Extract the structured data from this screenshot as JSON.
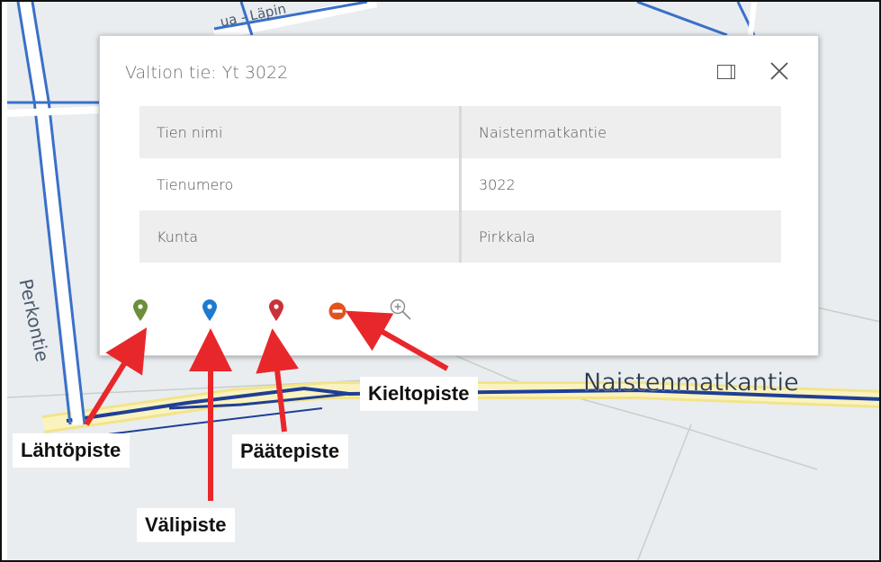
{
  "map": {
    "street_main": "Naistenmatkantie",
    "street_side": "Perkontie",
    "street_top": "ua - Läpin"
  },
  "popup": {
    "title": "Valtion tie: Yt 3022",
    "rows": [
      {
        "key": "Tien nimi",
        "value": "Naistenmatkantie"
      },
      {
        "key": "Tienumero",
        "value": "3022"
      },
      {
        "key": "Kunta",
        "value": "Pirkkala"
      }
    ],
    "tools": [
      {
        "name": "start-point-marker-icon",
        "color": "#6b8f3a"
      },
      {
        "name": "via-point-marker-icon",
        "color": "#1f7ad1"
      },
      {
        "name": "end-point-marker-icon",
        "color": "#c9323a"
      },
      {
        "name": "forbidden-point-icon",
        "color": "#e0531f"
      },
      {
        "name": "zoom-in-icon",
        "color": "#888888"
      }
    ]
  },
  "callouts": {
    "start": "Lähtöpiste",
    "via": "Välipiste",
    "end": "Päätepiste",
    "forbidden": "Kieltopiste"
  },
  "colors": {
    "arrow": "#e8272b",
    "road_highlight": "#1f3f95",
    "road_fill": "#f7ee9f"
  }
}
